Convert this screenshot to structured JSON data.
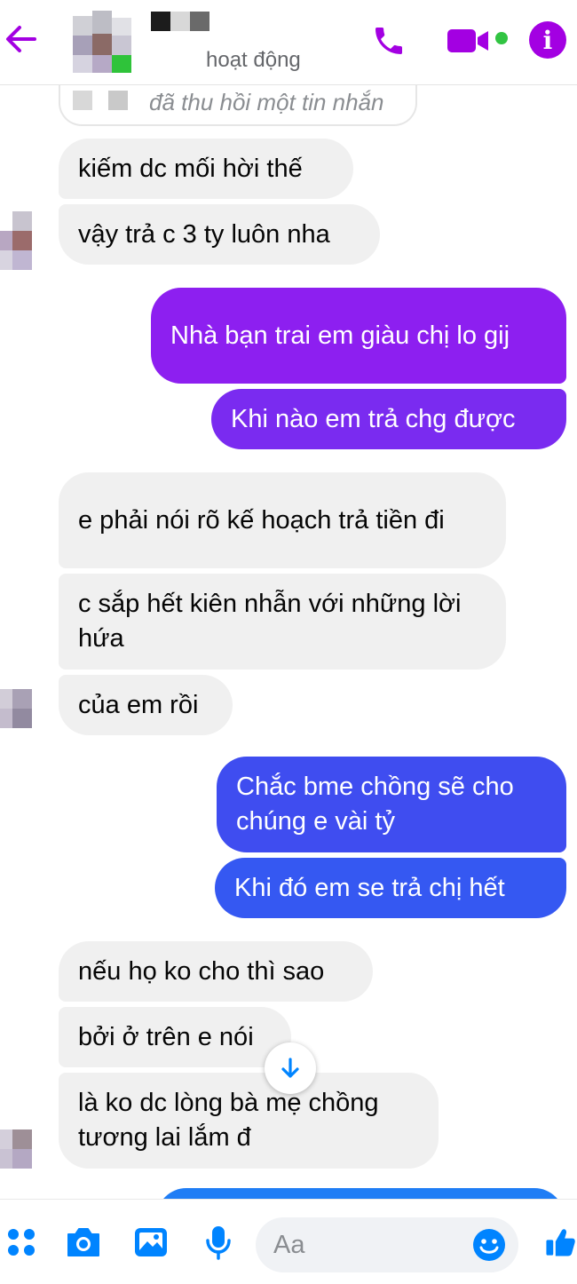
{
  "header": {
    "status": "hoạt động",
    "colors": {
      "accent": "#a300e2",
      "online": "#31c442"
    }
  },
  "chat": {
    "unsent_notice": "đã thu hồi một tin nhắn",
    "messages": [
      {
        "side": "in",
        "text": "kiếm dc mối hời thế"
      },
      {
        "side": "in",
        "text": "vậy trả c 3 ty luôn nha"
      },
      {
        "side": "out",
        "text": "Nhà bạn trai em giàu chị lo gij",
        "color": "#8d1ff0"
      },
      {
        "side": "out",
        "text": "Khi nào em trả chg được",
        "color": "#7a2bf0"
      },
      {
        "side": "in",
        "text": "e phải nói rõ kế hoạch trả tiền đi"
      },
      {
        "side": "in",
        "text": "c sắp hết kiên nhẫn với những lời hứa"
      },
      {
        "side": "in",
        "text": "của em rồi"
      },
      {
        "side": "out",
        "text": "Chắc bme chồng sẽ cho chúng e  vài tỷ",
        "color": "#3f4df0"
      },
      {
        "side": "out",
        "text": "Khi đó em se  trả chị hết",
        "color": "#3558f2"
      },
      {
        "side": "in",
        "text": "nếu họ ko cho thì sao"
      },
      {
        "side": "in",
        "text": "bởi ở trên e nói"
      },
      {
        "side": "in",
        "text": "là ko dc lòng bà mẹ chồng tương lai lắm đ"
      }
    ]
  },
  "composer": {
    "placeholder": "Aa",
    "icons": [
      "more-icon",
      "camera-icon",
      "gallery-icon",
      "microphone-icon",
      "emoji-icon",
      "like-icon"
    ],
    "icon_color": "#0084ff"
  }
}
